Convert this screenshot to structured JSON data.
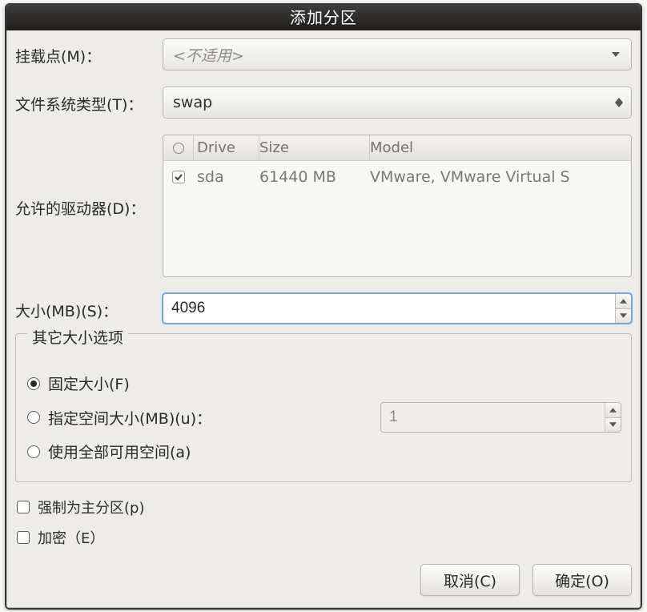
{
  "window": {
    "title": "添加分区"
  },
  "labels": {
    "mountpoint": "挂载点(M)：",
    "fstype": "文件系统类型(T)：",
    "drives": "允许的驱动器(D)：",
    "size": "大小(MB)(S)：",
    "group_title": "其它大小选项",
    "opt_fixed": "固定大小(F)",
    "opt_fillup": "指定空间大小(MB)(u)：",
    "opt_useall": "使用全部可用空间(a)",
    "force_primary": "强制为主分区(p)",
    "encrypt": "加密（E）"
  },
  "mountpoint": {
    "placeholder": "<不适用>"
  },
  "fstype": {
    "value": "swap"
  },
  "drive_table": {
    "headers": {
      "drive": "Drive",
      "size": "Size",
      "model": "Model"
    },
    "rows": [
      {
        "checked": true,
        "drive": "sda",
        "size": "61440 MB",
        "model": "VMware, VMware Virtual S"
      }
    ]
  },
  "size": {
    "value": "4096"
  },
  "size_options": {
    "selected": "fixed",
    "fill_up_value": "1"
  },
  "force_primary": false,
  "encrypt": false,
  "buttons": {
    "cancel": "取消(C)",
    "ok": "确定(O)"
  }
}
